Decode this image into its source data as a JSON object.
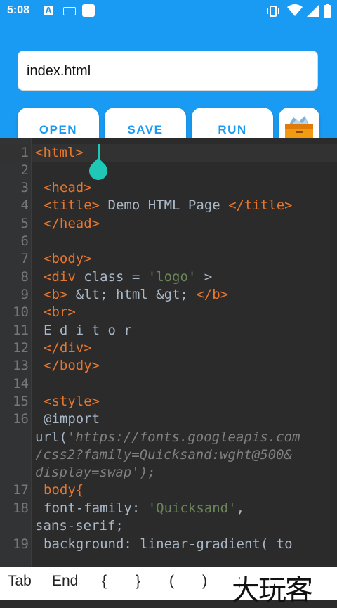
{
  "status_bar": {
    "time": "5:08"
  },
  "header": {
    "filename": "index.html",
    "buttons": {
      "open": "OPEN",
      "save": "SAVE",
      "run": "RUN"
    }
  },
  "editor": {
    "lines": [
      {
        "n": "1"
      },
      {
        "n": "2"
      },
      {
        "n": "3"
      },
      {
        "n": "4"
      },
      {
        "n": "5"
      },
      {
        "n": "6"
      },
      {
        "n": "7"
      },
      {
        "n": "8"
      },
      {
        "n": "9"
      },
      {
        "n": "10"
      },
      {
        "n": "11"
      },
      {
        "n": "12"
      },
      {
        "n": "13"
      },
      {
        "n": "14"
      },
      {
        "n": "15"
      },
      {
        "n": "16"
      },
      {
        "n": "17"
      },
      {
        "n": "18"
      },
      {
        "n": "19"
      }
    ],
    "code": {
      "l1": "<html>",
      "l3": "<head>",
      "l4a": "<title>",
      "l4b": " Demo HTML Page ",
      "l4c": "</title>",
      "l5": "</head>",
      "l7": "<body>",
      "l8a": "<div",
      "l8b": " class = ",
      "l8c": "'logo'",
      "l8d": " >",
      "l9a": "<b>",
      "l9b": " &lt; html &gt; ",
      "l9c": "</b>",
      "l10": "<br>",
      "l11": "E d i t o r",
      "l12": "</div>",
      "l13": "</body>",
      "l15": "<style>",
      "l16a": "@import",
      "l16b": "url(",
      "l16c": "'https://fonts.googleapis.com",
      "l16d": "/css2?family=Quicksand:wght@500&",
      "l16e": "display=swap'",
      "l16f": ");",
      "l17": "body{",
      "l18a": "font-family: ",
      "l18b": "'Quicksand'",
      "l18c": ",",
      "l18d": "sans-serif;",
      "l19": "background: linear-gradient( to"
    }
  },
  "bottom_bar": {
    "keys": [
      "Tab",
      "End",
      "{",
      "}",
      "(",
      ")",
      ";",
      ",",
      "."
    ],
    "watermark": "大玩客"
  }
}
